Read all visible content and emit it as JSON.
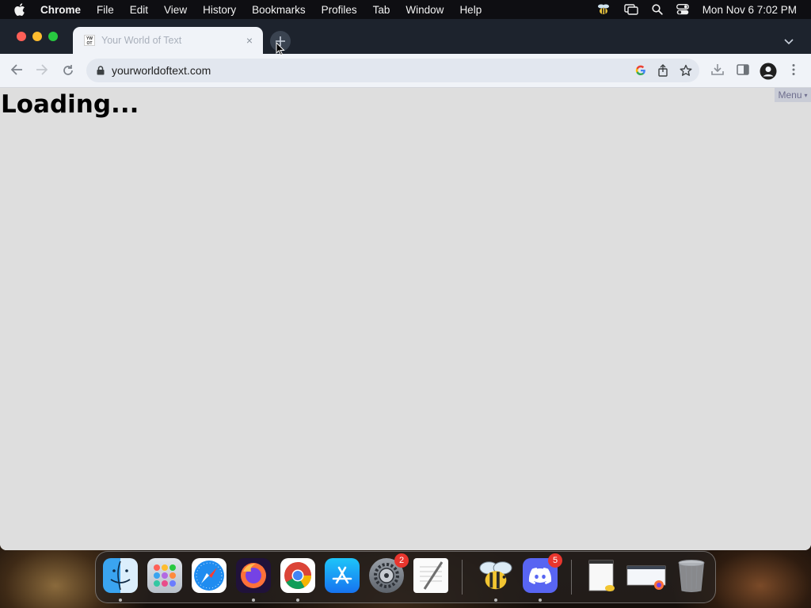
{
  "menubar": {
    "items": [
      "Chrome",
      "File",
      "Edit",
      "View",
      "History",
      "Bookmarks",
      "Profiles",
      "Tab",
      "Window",
      "Help"
    ],
    "clock": "Mon Nov 6  7:02 PM",
    "status_icons": [
      "bee-icon",
      "screen-mirroring-icon",
      "spotlight-search-icon",
      "control-center-icon"
    ]
  },
  "tab": {
    "title": "Your World of Text",
    "favicon_text": "YW OT",
    "close": "×"
  },
  "omnibox": {
    "url": "yourworldoftext.com"
  },
  "page": {
    "loading_text": "Loading...",
    "menu_label": "Menu",
    "menu_caret": "▾"
  },
  "dock": {
    "apps": [
      {
        "name": "Finder",
        "icon": "finder-icon",
        "running": true
      },
      {
        "name": "Launchpad",
        "icon": "launchpad-icon",
        "running": false
      },
      {
        "name": "Safari",
        "icon": "safari-icon",
        "running": false
      },
      {
        "name": "Firefox",
        "icon": "firefox-icon",
        "running": true
      },
      {
        "name": "Chrome",
        "icon": "chrome-icon",
        "running": true
      },
      {
        "name": "App Store",
        "icon": "app-store-icon",
        "running": false
      },
      {
        "name": "System Settings",
        "icon": "system-settings-icon",
        "running": false,
        "badge": "2"
      },
      {
        "name": "TextEdit",
        "icon": "textedit-icon",
        "running": false
      },
      {
        "name": "Bee",
        "icon": "bee-app-icon",
        "running": true
      },
      {
        "name": "Discord",
        "icon": "discord-icon",
        "running": true,
        "badge": "5"
      }
    ]
  },
  "colors": {
    "tabstrip": "#1d232d",
    "toolbar": "#f0f3f8",
    "page_bg": "#dedede",
    "badge": "#e8362e"
  }
}
